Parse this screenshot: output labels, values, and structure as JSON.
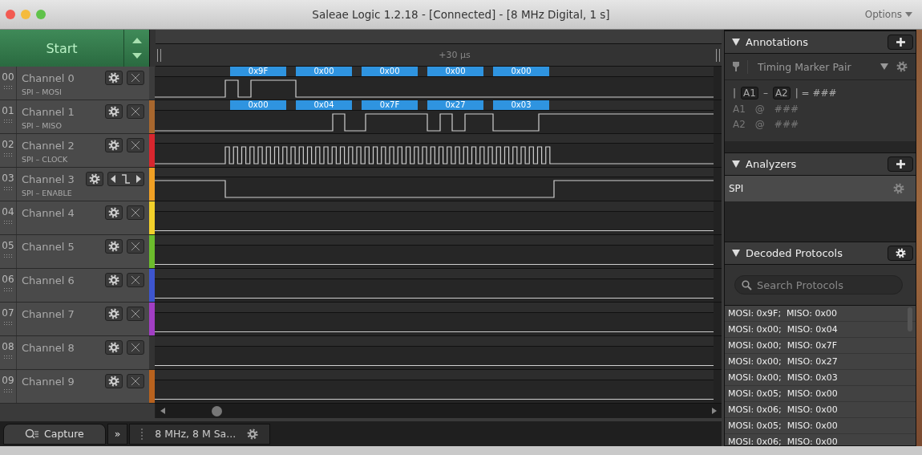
{
  "window": {
    "title": "Saleae Logic 1.2.18 - [Connected] - [8 MHz Digital, 1 s]",
    "options": "Options"
  },
  "start_button": "Start",
  "timeline": {
    "marker": "+30 µs"
  },
  "channels": [
    {
      "number": "00",
      "name": "Channel 0",
      "subtitle": "SPI – MOSI",
      "color": "#3c3c3c",
      "kind": "plain",
      "decoded": [
        "0x9F",
        "0x00",
        "0x00",
        "0x00",
        "0x00"
      ]
    },
    {
      "number": "01",
      "name": "Channel 1",
      "subtitle": "SPI – MISO",
      "color": "#a8672e",
      "kind": "plain",
      "decoded": [
        "0x00",
        "0x04",
        "0x7F",
        "0x27",
        "0x03"
      ]
    },
    {
      "number": "02",
      "name": "Channel 2",
      "subtitle": "SPI – CLOCK",
      "color": "#d8262e",
      "kind": "plain"
    },
    {
      "number": "03",
      "name": "Channel 3",
      "subtitle": "SPI – ENABLE",
      "color": "#f0a024",
      "kind": "trigger"
    },
    {
      "number": "04",
      "name": "Channel 4",
      "color": "#f2d02a",
      "kind": "plain"
    },
    {
      "number": "05",
      "name": "Channel 5",
      "color": "#6cbc2c",
      "kind": "plain"
    },
    {
      "number": "06",
      "name": "Channel 6",
      "color": "#3d55cf",
      "kind": "plain"
    },
    {
      "number": "07",
      "name": "Channel 7",
      "color": "#a23ec4",
      "kind": "plain"
    },
    {
      "number": "08",
      "name": "Channel 8",
      "color": "#333333",
      "kind": "plain"
    },
    {
      "number": "09",
      "name": "Channel 9",
      "color": "#b8621e",
      "kind": "plain"
    }
  ],
  "annotations": {
    "title": "Annotations",
    "marker_type": "Timing Marker Pair",
    "formula": {
      "open": "|",
      "a": "A1",
      "dash": "–",
      "b": "A2",
      "close": "| = ###"
    },
    "rows": [
      {
        "label": "A1",
        "at": "@",
        "value": "###"
      },
      {
        "label": "A2",
        "at": "@",
        "value": "###"
      }
    ]
  },
  "analyzers": {
    "title": "Analyzers",
    "items": [
      {
        "label": "SPI",
        "selected": true
      }
    ]
  },
  "decoded_protocols": {
    "title": "Decoded Protocols",
    "search": {
      "placeholder": "Search Protocols"
    },
    "rows": [
      "MOSI: 0x9F;  MISO: 0x00",
      "MOSI: 0x00;  MISO: 0x04",
      "MOSI: 0x00;  MISO: 0x7F",
      "MOSI: 0x00;  MISO: 0x27",
      "MOSI: 0x00;  MISO: 0x03",
      "MOSI: 0x05;  MISO: 0x00",
      "MOSI: 0x06;  MISO: 0x00",
      "MOSI: 0x05;  MISO: 0x00",
      "MOSI: 0x06;  MISO: 0x00"
    ]
  },
  "bottom_tabs": {
    "capture": "Capture",
    "more": "»",
    "session": "8 MHz, 8 M Sa..."
  }
}
